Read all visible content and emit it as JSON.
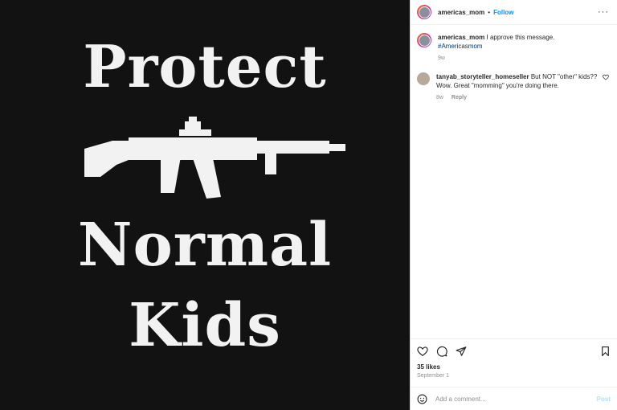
{
  "media": {
    "line1": "Protect",
    "line2": "Normal",
    "line3": "Kids"
  },
  "header": {
    "username": "americas_mom",
    "separator": "•",
    "follow_label": "Follow",
    "more_label": "···"
  },
  "caption": {
    "username": "americas_mom",
    "text": "I approve this message.",
    "hashtag": "#Americasmom",
    "time": "9w"
  },
  "comments": [
    {
      "username": "tanyab_storyteller_homeseller",
      "text": "But NOT \"other\" kids?? Wow. Great \"momming\" you're doing there.",
      "time": "8w",
      "reply_label": "Reply"
    }
  ],
  "stats": {
    "likes": "35 likes",
    "date": "September 1"
  },
  "add_comment": {
    "placeholder": "Add a comment...",
    "post_label": "Post"
  },
  "colors": {
    "accent": "#0095f6",
    "media_bg": "#121212",
    "post_disabled": "#b2dffc"
  }
}
